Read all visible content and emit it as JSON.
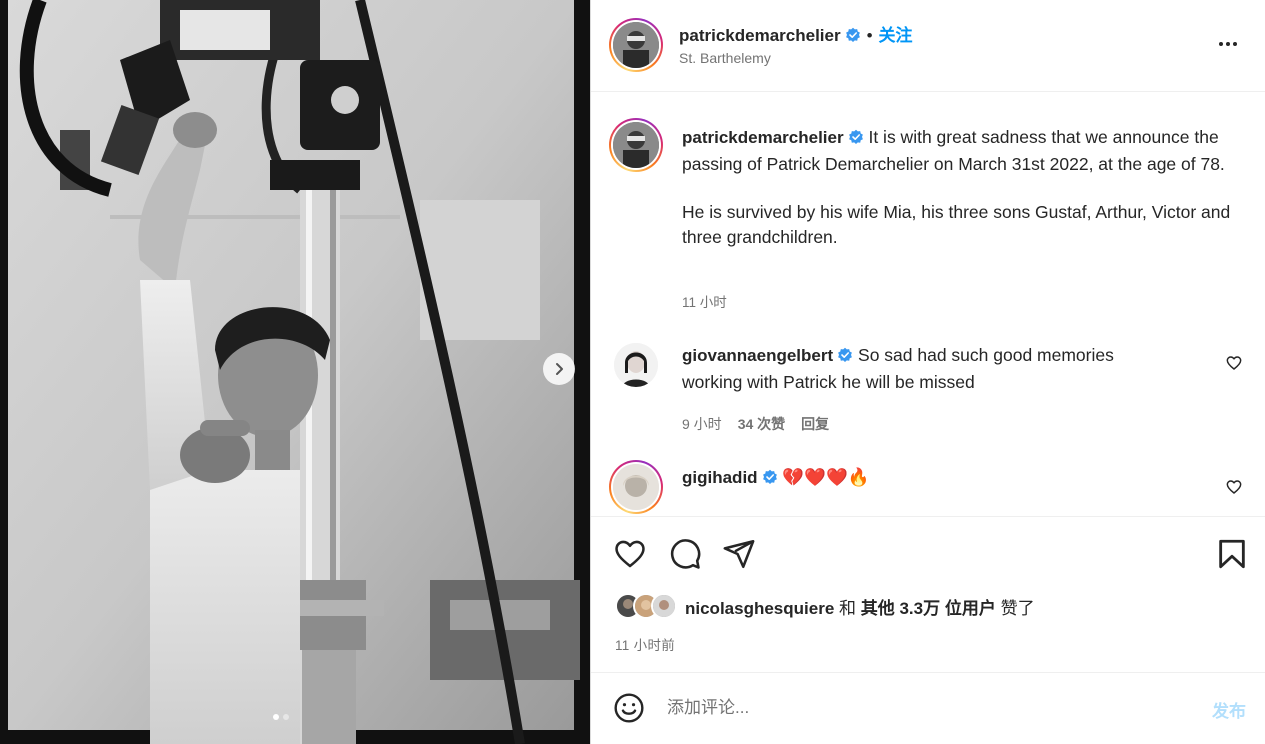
{
  "post": {
    "username": "patrickdemarchelier",
    "follow_label": "关注",
    "separator": "•",
    "location": "St. Barthelemy",
    "caption_p1": "It is with great sadness that we announce the passing of Patrick Demarchelier on March 31st 2022, at the age of 78.",
    "caption_p2": "He is survived by his wife Mia, his three sons Gustaf, Arthur, Victor and three grandchildren.",
    "caption_time": "11 小时"
  },
  "comments": [
    {
      "username": "giovannaengelbert",
      "text": "So sad had such good memories working with Patrick he will be missed",
      "time": "9 小时",
      "likes": "34 次赞",
      "reply_label": "回复"
    },
    {
      "username": "gigihadid",
      "text": "💔❤️❤️🔥"
    }
  ],
  "likes": {
    "user": "nicolasghesquiere",
    "and": "和",
    "others": "其他 3.3万 位用户",
    "suffix": "赞了"
  },
  "post_time": "11 小时前",
  "composer": {
    "placeholder": "添加评论...",
    "post_label": "发布"
  },
  "carousel": {
    "slide_count": 2,
    "active_slide": 1
  },
  "colors": {
    "accent": "#0095f6",
    "verified": "#3897f0",
    "muted_text": "#737373",
    "post_disabled": "#b2dffc"
  },
  "icons": [
    "chevron-right-icon",
    "more-icon",
    "verified-icon",
    "heart-icon",
    "comment-icon",
    "share-icon",
    "bookmark-icon",
    "emoji-icon"
  ]
}
